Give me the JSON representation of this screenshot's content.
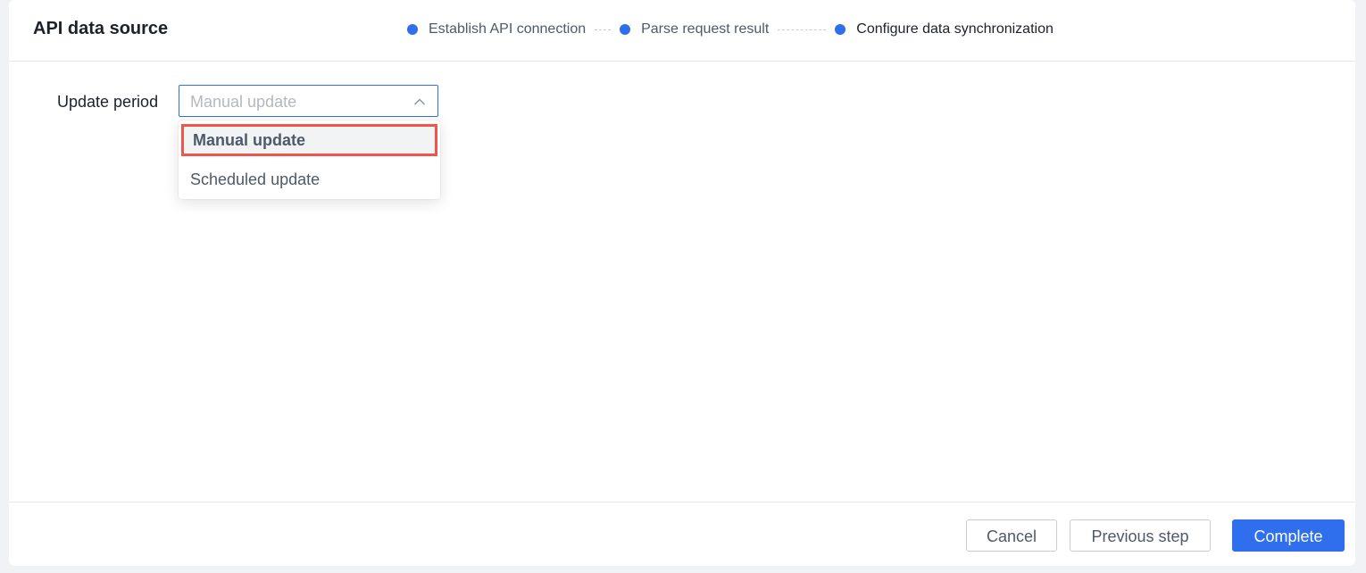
{
  "dialog": {
    "title": "API data source"
  },
  "steps": [
    {
      "label": "Establish API connection",
      "state": "done"
    },
    {
      "label": "Parse request result",
      "state": "done"
    },
    {
      "label": "Configure data synchronization",
      "state": "current"
    }
  ],
  "form": {
    "update_period_label": "Update period",
    "update_period_value": "Manual update",
    "update_period_icon": "chevron-up-icon",
    "options": [
      {
        "label": "Manual update",
        "selected": true
      },
      {
        "label": "Scheduled update",
        "selected": false
      }
    ]
  },
  "footer": {
    "cancel_label": "Cancel",
    "previous_label": "Previous step",
    "complete_label": "Complete"
  },
  "colors": {
    "accent": "#2f6fed",
    "highlight_border": "#f0554a",
    "text_primary": "#1d2129",
    "text_secondary": "#4e5969",
    "placeholder": "#b4b8bf"
  }
}
